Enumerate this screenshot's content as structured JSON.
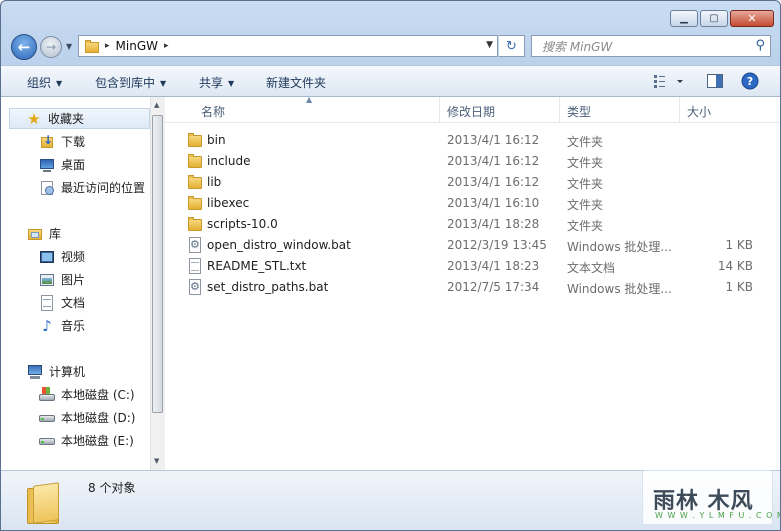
{
  "window": {
    "caption_buttons": [
      {
        "name": "minimize-button",
        "glyph": "▁"
      },
      {
        "name": "maximize-button",
        "glyph": "▢"
      },
      {
        "name": "close-button",
        "glyph": "✕"
      }
    ]
  },
  "address": {
    "crumb": "MinGW",
    "separator": "▸",
    "dropdown": "▼",
    "refresh_glyph": "↻"
  },
  "search": {
    "placeholder": "搜索 MinGW",
    "icon": "search-icon"
  },
  "toolbar": {
    "organize": "组织",
    "include_in_library": "包含到库中",
    "share": "共享",
    "new_folder": "新建文件夹",
    "caret": "▼"
  },
  "nav": {
    "favorites": {
      "label": "收藏夹",
      "items": [
        "下载",
        "桌面",
        "最近访问的位置"
      ]
    },
    "libraries": {
      "label": "库",
      "items": [
        "视频",
        "图片",
        "文档",
        "音乐"
      ]
    },
    "computer": {
      "label": "计算机",
      "items": [
        "本地磁盘 (C:)",
        "本地磁盘 (D:)",
        "本地磁盘 (E:)"
      ]
    }
  },
  "columns": {
    "name": "名称",
    "date": "修改日期",
    "type": "类型",
    "size": "大小",
    "sort_indicator": "▲"
  },
  "files": [
    {
      "name": "bin",
      "date": "2013/4/1 16:12",
      "type": "文件夹",
      "size": "",
      "icon": "folder-icon"
    },
    {
      "name": "include",
      "date": "2013/4/1 16:12",
      "type": "文件夹",
      "size": "",
      "icon": "folder-icon"
    },
    {
      "name": "lib",
      "date": "2013/4/1 16:12",
      "type": "文件夹",
      "size": "",
      "icon": "folder-icon"
    },
    {
      "name": "libexec",
      "date": "2013/4/1 16:10",
      "type": "文件夹",
      "size": "",
      "icon": "folder-icon"
    },
    {
      "name": "scripts-10.0",
      "date": "2013/4/1 18:28",
      "type": "文件夹",
      "size": "",
      "icon": "folder-icon"
    },
    {
      "name": "open_distro_window.bat",
      "date": "2012/3/19 13:45",
      "type": "Windows 批处理...",
      "size": "1 KB",
      "icon": "batch-file-icon"
    },
    {
      "name": "README_STL.txt",
      "date": "2013/4/1 18:23",
      "type": "文本文档",
      "size": "14 KB",
      "icon": "text-file-icon"
    },
    {
      "name": "set_distro_paths.bat",
      "date": "2012/7/5 17:34",
      "type": "Windows 批处理...",
      "size": "1 KB",
      "icon": "batch-file-icon"
    }
  ],
  "status": {
    "count": "8 个对象"
  },
  "watermark": {
    "title": "雨林 木风",
    "subtitle": "W W W . Y L M F U . C O M"
  },
  "colors": {
    "accent": "#2c68b9",
    "folder": "#e3b133",
    "close": "#c44a31"
  }
}
